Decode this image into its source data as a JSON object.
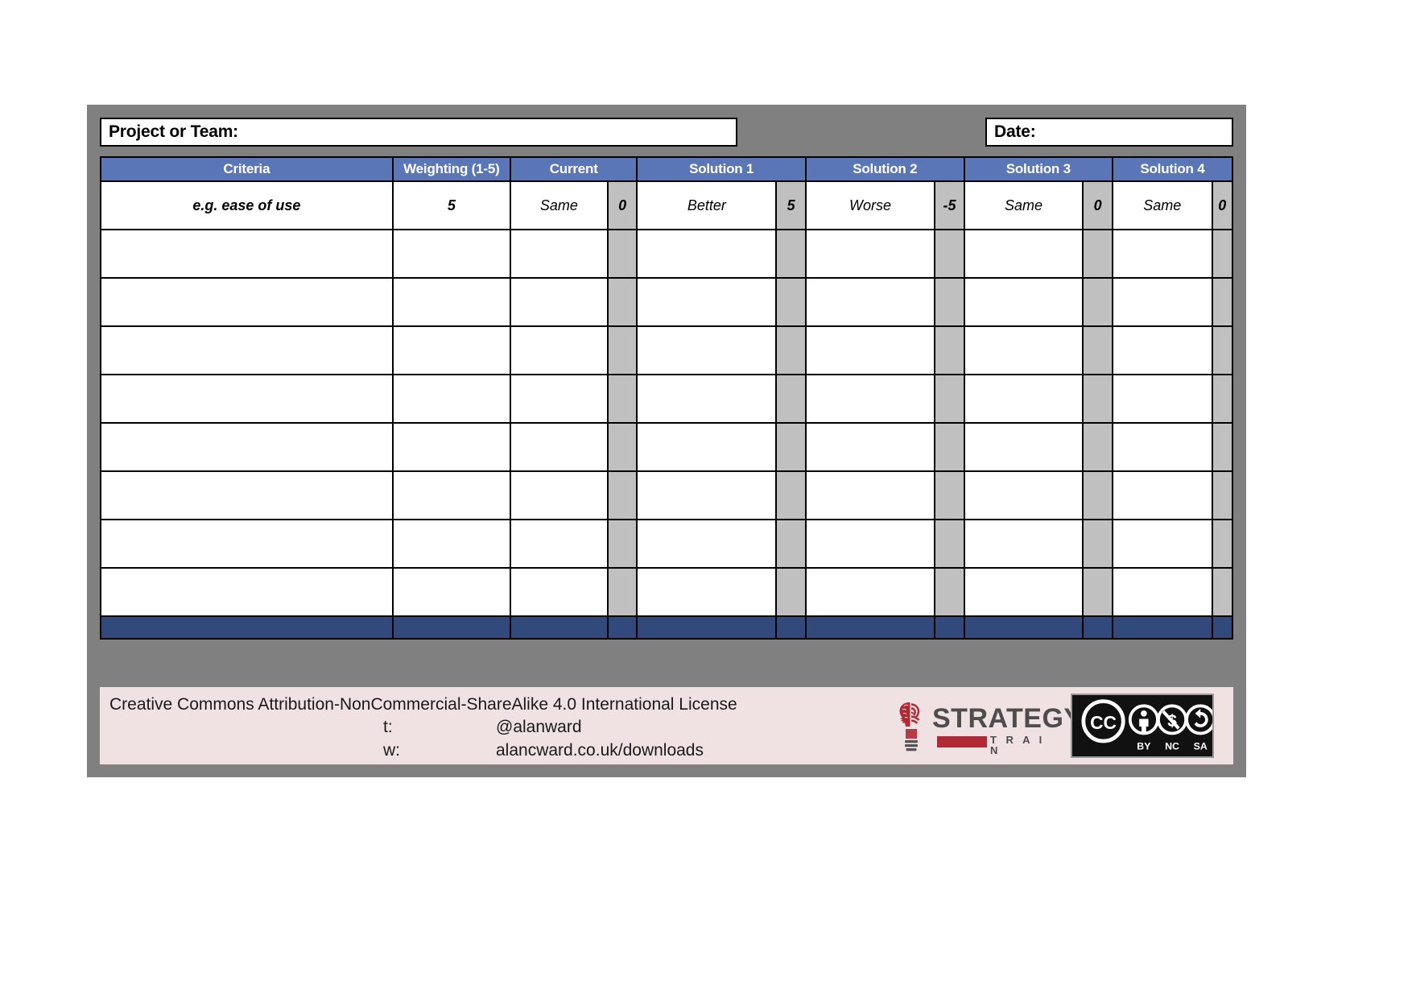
{
  "form": {
    "project_label": "Project or Team:",
    "project_value": "",
    "date_label": "Date:",
    "date_value": ""
  },
  "table": {
    "headers": [
      "Criteria",
      "Weighting (1-5)",
      "Current",
      "Solution 1",
      "Solution 2",
      "Solution 3",
      "Solution 4"
    ],
    "example_row": {
      "criteria": "e.g. ease of use",
      "weighting": "5",
      "current_judgement": "Same",
      "current_score": "0",
      "solution1_judgement": "Better",
      "solution1_score": "5",
      "solution2_judgement": "Worse",
      "solution2_score": "-5",
      "solution3_judgement": "Same",
      "solution3_score": "0",
      "solution4_judgement": "Same",
      "solution4_score": "0"
    },
    "blank_row_count": 8
  },
  "footer": {
    "license": "Creative Commons Attribution-NonCommercial-ShareAlike 4.0 International License",
    "twitter_key": "t:",
    "twitter_value": "@alanward",
    "web_key": "w:",
    "web_value": "alancward.co.uk/downloads",
    "logo_word": "STRATEGY",
    "logo_sub": "T R A I N",
    "cc_labels": [
      "BY",
      "NC",
      "SA"
    ]
  },
  "colors": {
    "header_blue": "#5b76b7",
    "totals_blue": "#31497b",
    "score_grey": "#c0c0c0",
    "frame_grey": "#808080",
    "footer_pink": "#f0e2e2",
    "logo_red": "#b02a35"
  }
}
